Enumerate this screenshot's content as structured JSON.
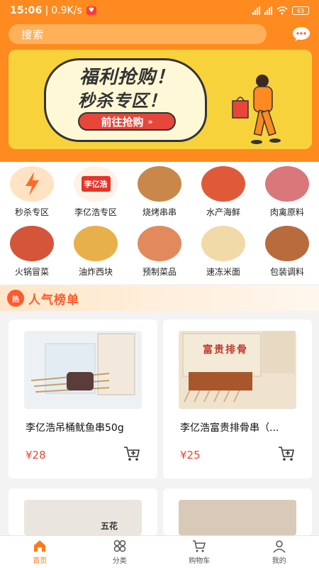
{
  "status": {
    "time": "15:06",
    "speed": "0.9K/s",
    "battery": "63"
  },
  "search": {
    "placeholder": "搜索"
  },
  "banner": {
    "line1": "福利抢购！",
    "line2": "秒杀专区！",
    "cta": "前往抢购"
  },
  "categories": [
    {
      "label": "秒杀专区",
      "icon": "lightning-icon",
      "badge": ""
    },
    {
      "label": "李亿浩专区",
      "icon": "brand-logo-icon",
      "badge": "李亿浩"
    },
    {
      "label": "烧烤串串",
      "icon": "skewers-icon",
      "badge": ""
    },
    {
      "label": "水产海鲜",
      "icon": "lobster-icon",
      "badge": ""
    },
    {
      "label": "肉禽原料",
      "icon": "meat-icon",
      "badge": ""
    },
    {
      "label": "火锅冒菜",
      "icon": "hotpot-icon",
      "badge": ""
    },
    {
      "label": "油炸西块",
      "icon": "fried-food-icon",
      "badge": ""
    },
    {
      "label": "预制菜品",
      "icon": "prepared-dish-icon",
      "badge": ""
    },
    {
      "label": "速冻米面",
      "icon": "dumpling-icon",
      "badge": ""
    },
    {
      "label": "包装调料",
      "icon": "spices-icon",
      "badge": ""
    }
  ],
  "ranking": {
    "title": "人气榜单",
    "badge": "热"
  },
  "products": [
    {
      "name": "李亿浩吊桶鱿鱼串50g",
      "price": "¥28"
    },
    {
      "name": "李亿浩富贵排骨串（...",
      "price": "¥25",
      "package_label": "富贵排骨"
    },
    {
      "name": "",
      "price": "",
      "package_label": "五花"
    },
    {
      "name": "",
      "price": ""
    }
  ],
  "tabbar": [
    {
      "label": "首页",
      "icon": "home-icon",
      "active": true
    },
    {
      "label": "分类",
      "icon": "category-icon",
      "active": false
    },
    {
      "label": "购物车",
      "icon": "cart-icon",
      "active": false
    },
    {
      "label": "我的",
      "icon": "user-icon",
      "active": false
    }
  ],
  "colors": {
    "brand": "#ff8a1f",
    "price": "#f0442f",
    "banner": "#f8d23b"
  }
}
